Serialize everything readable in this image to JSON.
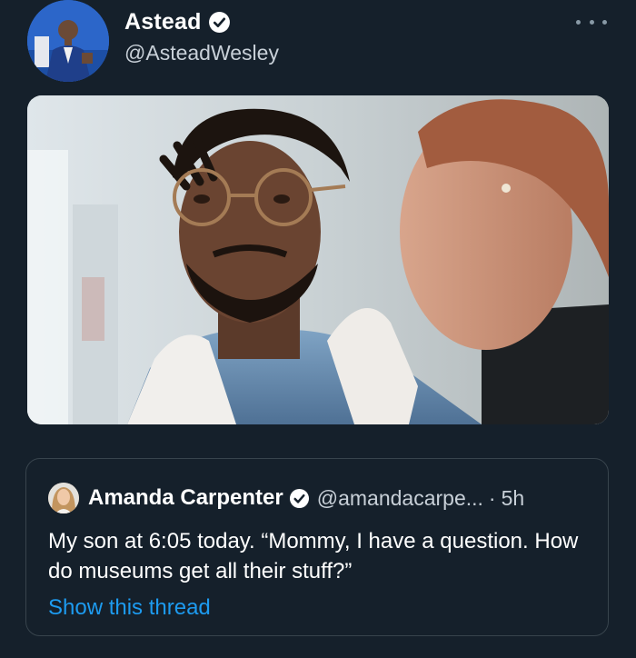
{
  "author": {
    "display_name": "Astead",
    "handle": "@AsteadWesley",
    "verified": true,
    "avatar_icon": "profile-photo-man-in-blue-suit"
  },
  "tweet": {
    "more_icon": "more-options-icon",
    "media_description_icon": "photo-man-with-glasses-and-woman"
  },
  "quoted_tweet": {
    "display_name": "Amanda Carpenter",
    "verified": true,
    "handle": "@amandacarpe...",
    "separator": "·",
    "time": "5h",
    "text": "My son at 6:05 today. “Mommy, I have a question. How do museums get all their stuff?”",
    "show_thread": "Show this thread"
  },
  "colors": {
    "background": "#15202b",
    "link": "#1d9bf0",
    "secondary_text": "#c8d0d8",
    "border": "#38444d"
  }
}
